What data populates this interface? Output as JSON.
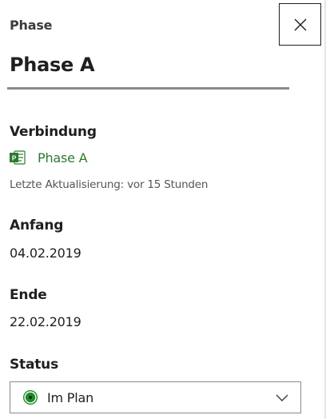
{
  "pane": {
    "header_label": "Phase",
    "title": "Phase A",
    "close_icon": "close-icon"
  },
  "connection": {
    "label": "Verbindung",
    "icon": "ms-project-icon",
    "link_text": "Phase A",
    "last_update": "Letzte Aktualisierung: vor 15 Stunden",
    "link_color": "#2a7b2f"
  },
  "start": {
    "label": "Anfang",
    "value": "04.02.2019"
  },
  "end": {
    "label": "Ende",
    "value": "22.02.2019"
  },
  "status": {
    "label": "Status",
    "selected": "Im Plan",
    "indicator_color": "#1e8a2a",
    "icon": "status-on-track-icon",
    "chevron_icon": "chevron-down-icon"
  }
}
